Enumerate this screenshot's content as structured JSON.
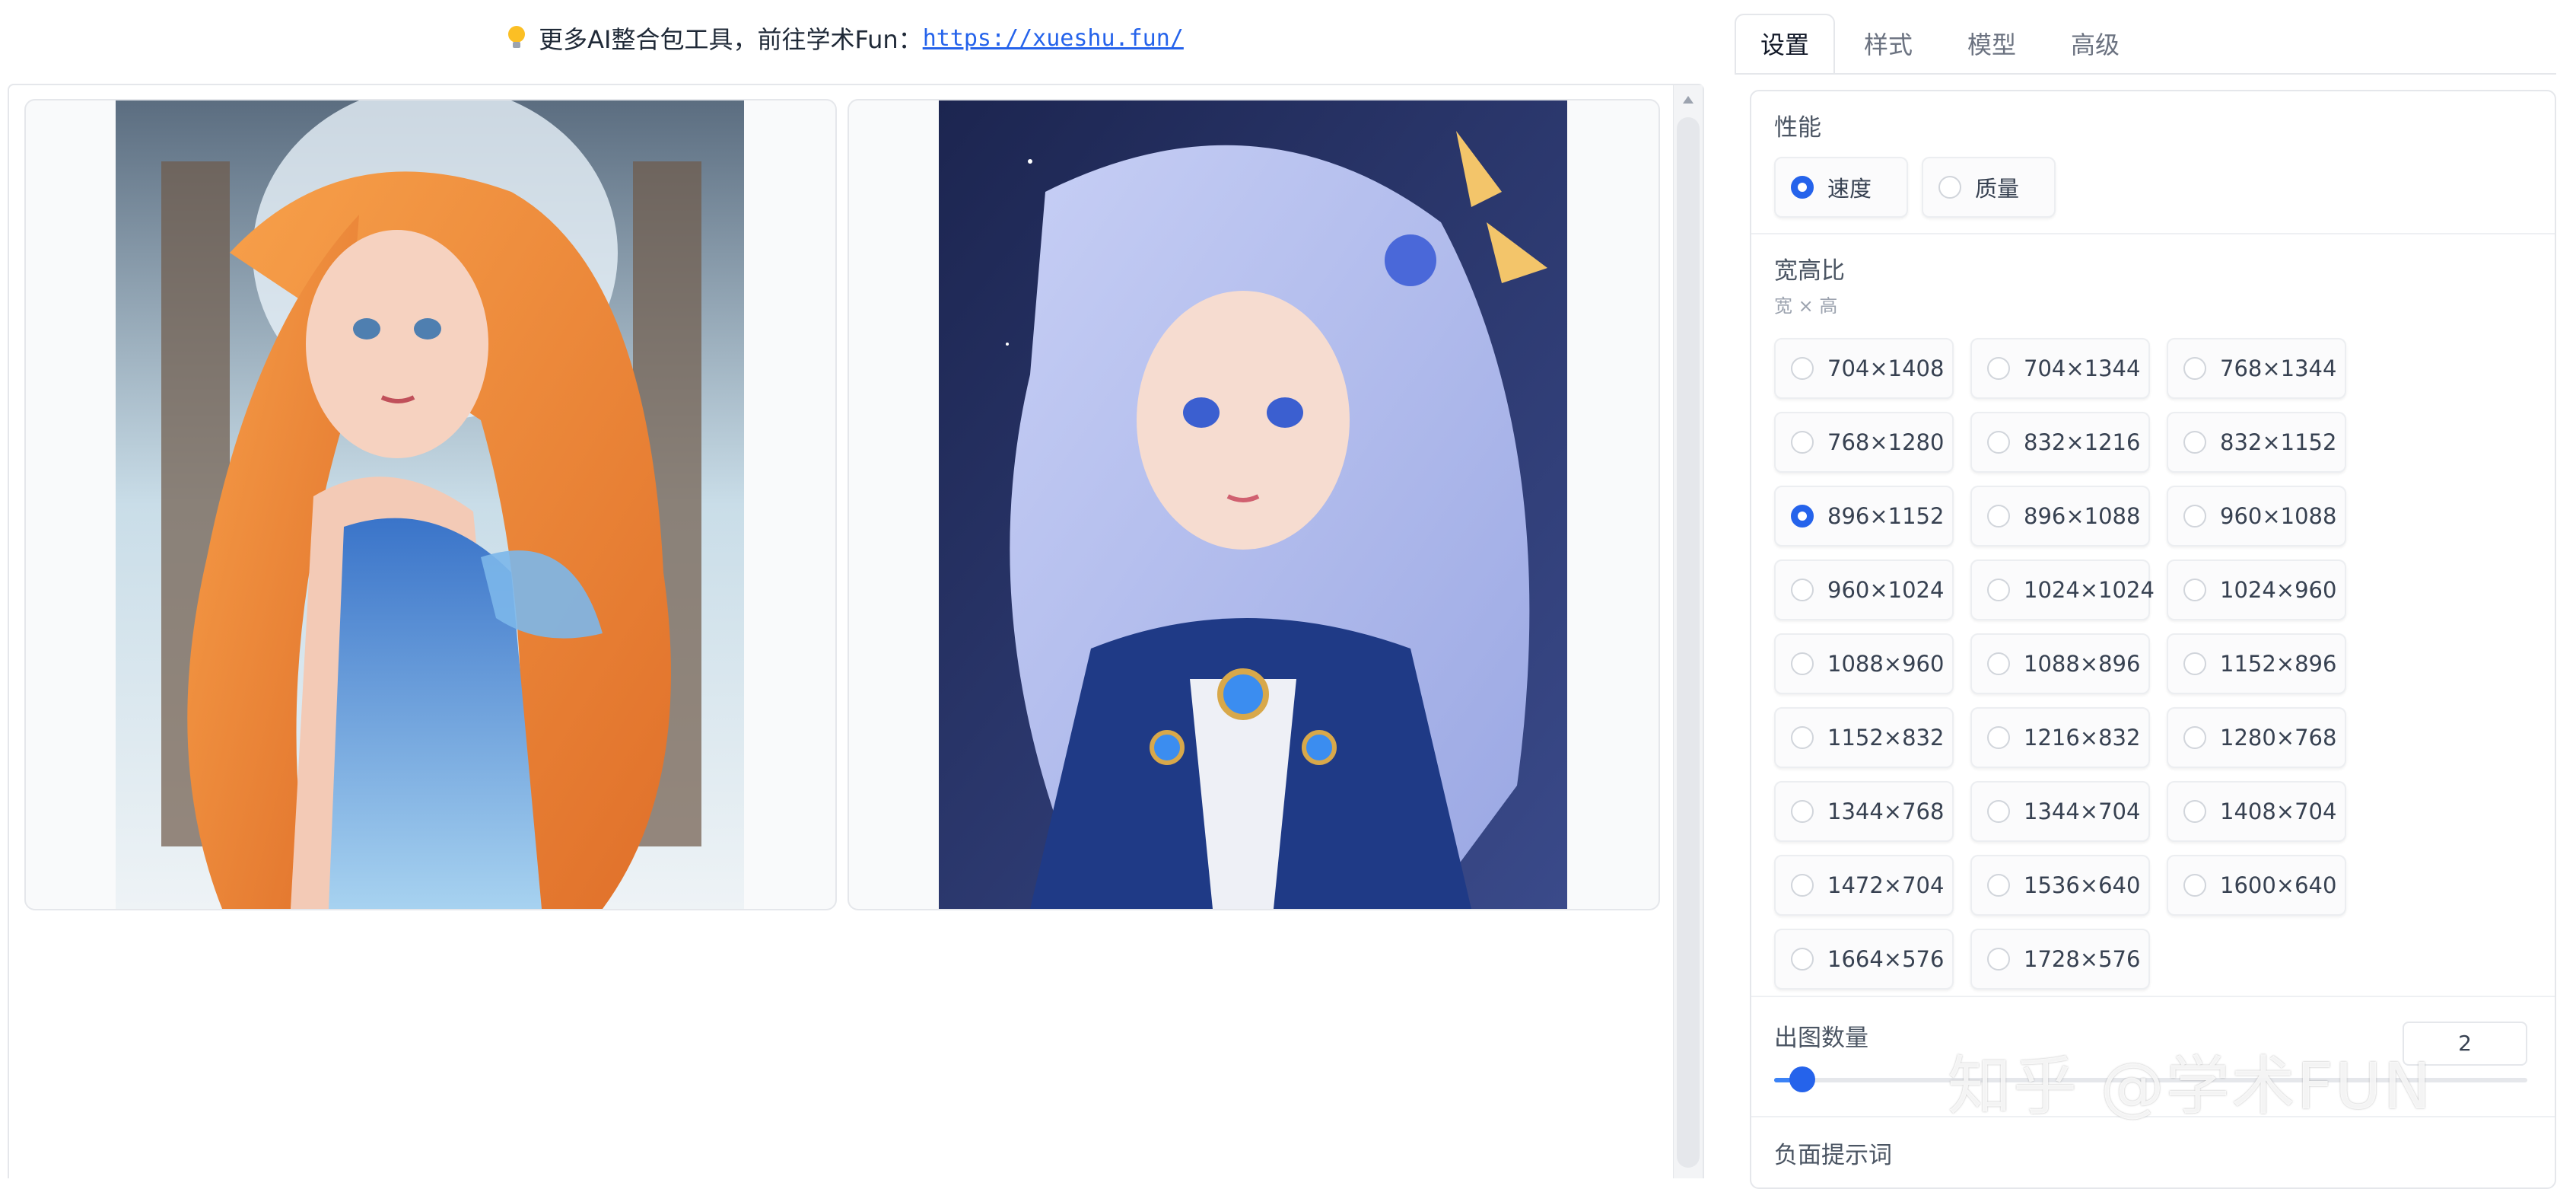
{
  "banner": {
    "text": "更多AI整合包工具，前往学术Fun：",
    "link": "https://xueshu.fun/"
  },
  "tabs": [
    "设置",
    "样式",
    "模型",
    "高级"
  ],
  "performance": {
    "label": "性能",
    "options": [
      "速度",
      "质量"
    ],
    "selected": "速度"
  },
  "aspect": {
    "label": "宽高比",
    "sublabel": "宽 × 高",
    "selected": "896×1152",
    "options": [
      "704×1408",
      "704×1344",
      "768×1344",
      "768×1280",
      "832×1216",
      "832×1152",
      "896×1152",
      "896×1088",
      "960×1088",
      "960×1024",
      "1024×1024",
      "1024×960",
      "1088×960",
      "1088×896",
      "1152×896",
      "1152×832",
      "1216×832",
      "1280×768",
      "1344×768",
      "1344×704",
      "1408×704",
      "1472×704",
      "1536×640",
      "1600×640",
      "1664×576",
      "1728×576"
    ]
  },
  "image_count": {
    "label": "出图数量",
    "value": "2"
  },
  "negative_prompt": {
    "label": "负面提示词"
  },
  "watermark": "知乎 @学术FUN",
  "colors": {
    "accent": "#2563eb",
    "link": "#2563eb",
    "border": "#e5e7eb"
  }
}
